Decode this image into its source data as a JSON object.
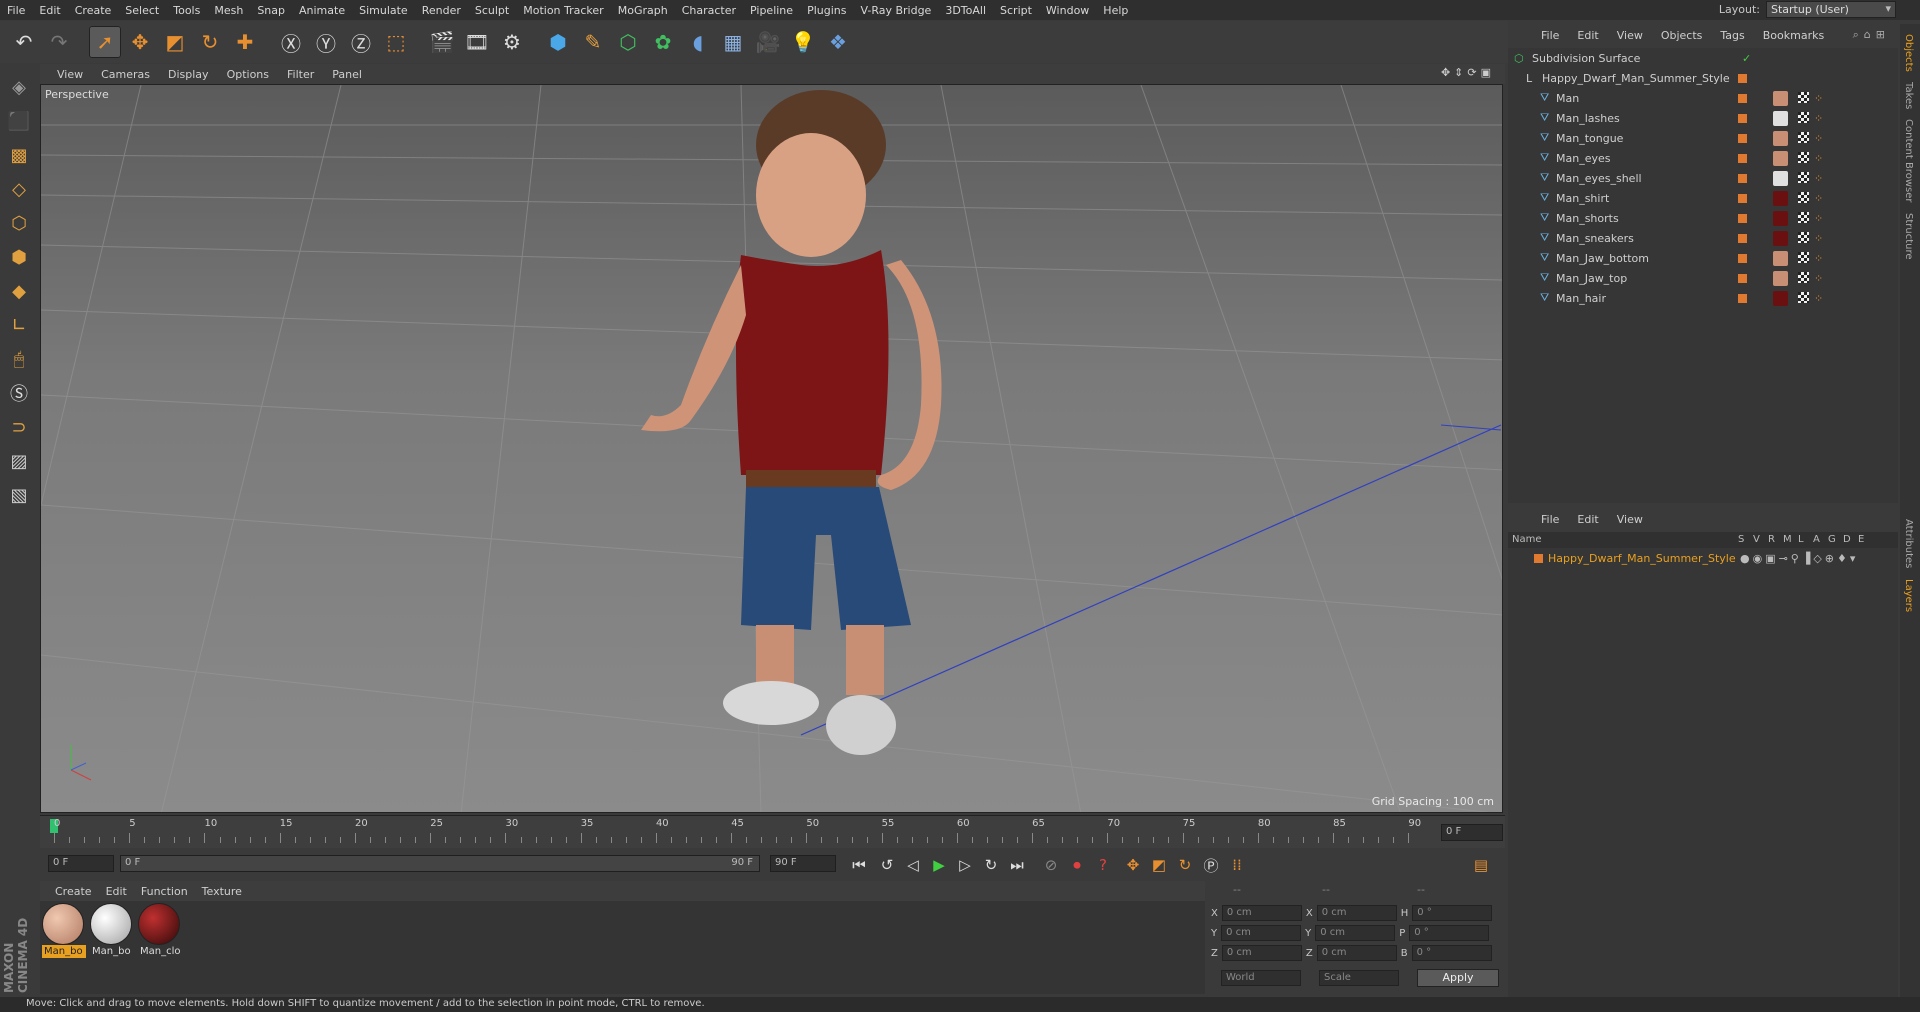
{
  "menubar": {
    "items": [
      "File",
      "Edit",
      "Create",
      "Select",
      "Tools",
      "Mesh",
      "Snap",
      "Animate",
      "Simulate",
      "Render",
      "Sculpt",
      "Motion Tracker",
      "MoGraph",
      "Character",
      "Pipeline",
      "Plugins",
      "V-Ray Bridge",
      "3DToAll",
      "Script",
      "Window",
      "Help"
    ],
    "layout_label": "Layout:",
    "layout_value": "Startup (User)"
  },
  "viewport": {
    "menu": [
      "View",
      "Cameras",
      "Display",
      "Options",
      "Filter",
      "Panel"
    ],
    "label": "Perspective",
    "grid_spacing": "Grid Spacing : 100 cm"
  },
  "timeline": {
    "ticks": [
      "0",
      "5",
      "10",
      "15",
      "20",
      "25",
      "30",
      "35",
      "40",
      "45",
      "50",
      "55",
      "60",
      "65",
      "70",
      "75",
      "80",
      "85",
      "90"
    ],
    "end_field": "0 F",
    "start_field": "0 F",
    "range_start": "0 F",
    "range_end": "90 F",
    "max_field": "90 F"
  },
  "materials": {
    "menu": [
      "Create",
      "Edit",
      "Function",
      "Texture"
    ],
    "items": [
      {
        "label": "Man_bo",
        "color": "#c9967a",
        "selected": true
      },
      {
        "label": "Man_bo",
        "color": "#d8d8d8",
        "selected": false
      },
      {
        "label": "Man_clo",
        "color": "#6a1010",
        "selected": false
      }
    ]
  },
  "coords": {
    "rows": [
      {
        "a": "X",
        "av": "0 cm",
        "b": "X",
        "bv": "0 cm",
        "c": "H",
        "cv": "0 °"
      },
      {
        "a": "Y",
        "av": "0 cm",
        "b": "Y",
        "bv": "0 cm",
        "c": "P",
        "cv": "0 °"
      },
      {
        "a": "Z",
        "av": "0 cm",
        "b": "Z",
        "bv": "0 cm",
        "c": "B",
        "cv": "0 °"
      }
    ],
    "world": "World",
    "scale": "Scale",
    "apply": "Apply",
    "dash1": "--",
    "dash2": "--",
    "dash3": "--"
  },
  "objects": {
    "menu": [
      "File",
      "Edit",
      "View",
      "Objects",
      "Tags",
      "Bookmarks"
    ],
    "root": "Subdivision Surface",
    "group": "Happy_Dwarf_Man_Summer_Style",
    "children": [
      "Man",
      "Man_lashes",
      "Man_tongue",
      "Man_eyes",
      "Man_eyes_shell",
      "Man_shirt",
      "Man_shorts",
      "Man_sneakers",
      "Man_Jaw_bottom",
      "Man_Jaw_top",
      "Man_hair"
    ]
  },
  "layers": {
    "menu": [
      "File",
      "Edit",
      "View"
    ],
    "header_name": "Name",
    "header_cols": [
      "S",
      "V",
      "R",
      "M",
      "L",
      "A",
      "G",
      "D",
      "E"
    ],
    "rows": [
      "Happy_Dwarf_Man_Summer_Style"
    ]
  },
  "right_tabs": [
    "Objects",
    "Takes",
    "Content Browser",
    "Structure",
    "Attributes",
    "Layers"
  ],
  "status": "Move: Click and drag to move elements. Hold down SHIFT to quantize movement / add to the selection in point mode, CTRL to remove.",
  "brand": "MAXON CINEMA 4D"
}
